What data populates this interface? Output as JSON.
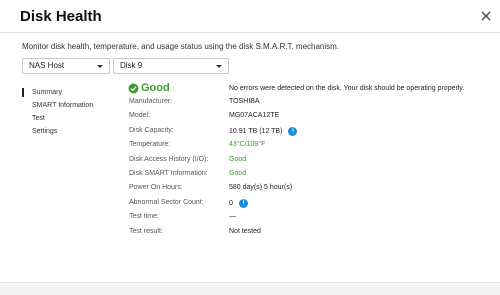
{
  "window": {
    "title": "Disk Health"
  },
  "description": "Monitor disk health, temperature, and usage status using the disk S.M.A.R.T. mechanism.",
  "selects": {
    "host": "NAS Host",
    "disk": "Disk 9"
  },
  "sidebar": {
    "items": [
      "Summary",
      "SMART Information",
      "Test",
      "Settings"
    ],
    "active": "Summary"
  },
  "status": {
    "label": "Good",
    "message": "No errors were detected on the disk. Your disk should be operating properly."
  },
  "details": [
    {
      "label": "Manufacturer:",
      "value": "TOSHIBA"
    },
    {
      "label": "Model:",
      "value": "MG07ACA12TE"
    },
    {
      "label": "Disk Capacity:",
      "value": "10.91 TB (12 TB)"
    },
    {
      "label": "Temperature:",
      "value": "43°C/109°F"
    },
    {
      "label": "Disk Access History (I/O):",
      "value": "Good"
    },
    {
      "label": "Disk SMART Information:",
      "value": "Good"
    },
    {
      "label": "Power On Hours:",
      "value": "580 day(s) 5 hour(s)"
    },
    {
      "label": "Abnormal Sector Count:",
      "value": "0"
    },
    {
      "label": "Test time:",
      "value": "—"
    },
    {
      "label": "Test result:",
      "value": "Not tested"
    }
  ],
  "icons": {
    "info": "i"
  },
  "colors": {
    "good": "#3e9e2a",
    "info": "#1a8bd6"
  }
}
